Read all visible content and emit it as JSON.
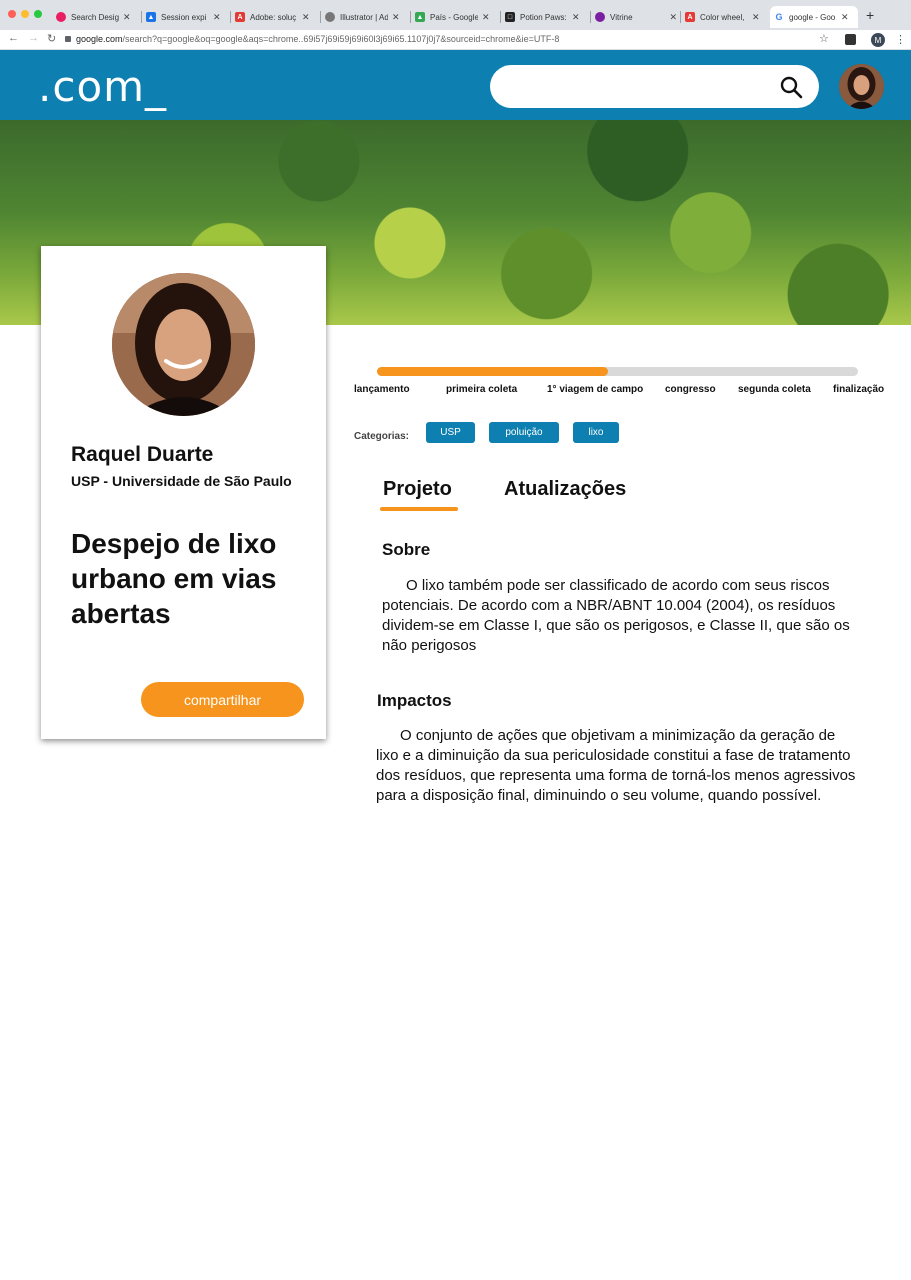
{
  "browser": {
    "tabs": [
      {
        "title": "Search Desig",
        "color": "#e91e63"
      },
      {
        "title": "Session expi",
        "color": "#1a73e8"
      },
      {
        "title": "Adobe: soluç",
        "color": "#e53935"
      },
      {
        "title": "Illustrator | Ad",
        "color": "#777777"
      },
      {
        "title": "País - Google",
        "color": "#34a853"
      },
      {
        "title": "Potion Paws:",
        "color": "#222222"
      },
      {
        "title": "Vitrine",
        "color": "#7b1fa2"
      },
      {
        "title": "Color wheel, ",
        "color": "#e53935"
      },
      {
        "title": "google - Goo",
        "color": "#4285f4"
      }
    ],
    "url_domain": "google.com",
    "url_rest": "/search?q=google&oq=google&aqs=chrome..69i57j69i59j69i60l3j69i65.1107j0j7&sourceid=chrome&ie=UTF-8",
    "profile_initial": "M"
  },
  "header": {
    "logo": ".com_",
    "search_placeholder": "",
    "brand_color": "#0d7fb0"
  },
  "profile": {
    "name": "Raquel Duarte",
    "institution": "USP - Universidade de São Paulo",
    "project_title": "Despejo de lixo urbano em vias abertas",
    "share_label": "compartilhar",
    "accent_color": "#f7941d"
  },
  "progress": {
    "fraction_complete": 0.48,
    "milestones": [
      "lançamento",
      "primeira coleta",
      "1° viagem de campo",
      "congresso",
      "segunda coleta",
      "finalização"
    ]
  },
  "categories": {
    "label": "Categorias:",
    "tags": [
      "USP",
      "poluição",
      "lixo"
    ]
  },
  "tabs": {
    "project": "Projeto",
    "updates": "Atualizações"
  },
  "content": {
    "about_heading": "Sobre",
    "about_text": "O lixo também pode ser classificado de acordo com seus riscos potenciais. De acordo com a NBR/ABNT 10.004 (2004), os resíduos dividem-se em Classe I, que são os perigosos, e Classe II, que são os não perigosos",
    "impacts_heading": "Impactos",
    "impacts_text": "O conjunto de ações que objetivam a minimização da geração de lixo e a diminuição da sua periculosidade constitui a fase de tratamento dos resíduos, que representa uma forma de torná-los menos agressivos para a disposição final, diminuindo o seu volume, quando possível."
  }
}
